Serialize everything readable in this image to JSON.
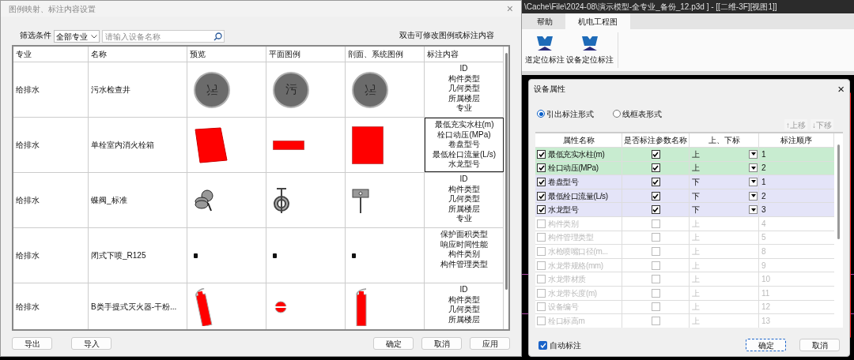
{
  "app": {
    "title": "\\Cache\\File\\2024-08\\演示模型-全专业_备份_12.p3d ] - [[二维-3F][视图1]]",
    "tabs": [
      {
        "label": "帮助",
        "selected": false
      },
      {
        "label": "机电工程图",
        "selected": true
      }
    ],
    "ribbon_buttons": [
      "道定位标注",
      "设备定位标注"
    ]
  },
  "legend_dialog": {
    "title": "图例映射、标注内容设置",
    "close": "×",
    "filter_label": "筛选条件",
    "specialty": "全部专业",
    "search": {
      "placeholder": "请输入设备名称"
    },
    "hint": "双击可修改图例或标注内容",
    "columns": [
      "专业",
      "名称",
      "预览",
      "平面图例",
      "剖面、系统图例",
      "标注内容"
    ],
    "rows": [
      {
        "specialty": "给排水",
        "name": "污水检查井",
        "kind": "manhole",
        "symbols": [
          "污",
          "污",
          "污"
        ],
        "annotations": [
          "ID",
          "构件类型",
          "几何类型",
          "所属楼层",
          "专业"
        ],
        "selected": false
      },
      {
        "specialty": "给排水",
        "name": "单栓室内消火栓箱",
        "kind": "hydrant_box",
        "annotations": [
          "最低充实水柱(m)",
          "栓口动压(MPa)",
          "卷盘型号",
          "最低栓口流量(L/s)",
          "水龙型号"
        ],
        "selected": true
      },
      {
        "specialty": "给排水",
        "name": "蝶阀_标准",
        "kind": "valve",
        "annotations": [
          "ID",
          "构件类型",
          "几何类型",
          "所属楼层",
          "专业"
        ],
        "selected": false
      },
      {
        "specialty": "给排水",
        "name": "闭式下喷_R125",
        "kind": "sprinkler",
        "annotations": [
          "保护面积类型",
          "响应时间性能",
          "构件类别",
          "构件管理类型"
        ],
        "selected": false
      },
      {
        "specialty": "给排水",
        "name": "B类手提式灭火器-干粉...",
        "kind": "extinguisher",
        "annotations": [
          "ID",
          "构件类型",
          "几何类型",
          "所属楼层"
        ],
        "selected": false
      }
    ],
    "left_buttons": [
      "导出",
      "导入"
    ],
    "right_buttons": [
      "确定",
      "取消",
      "应用"
    ]
  },
  "property_dialog": {
    "title": "设备属性",
    "close": "×",
    "modes": [
      {
        "label": "引出标注形式",
        "selected": true
      },
      {
        "label": "线框表形式",
        "selected": false
      }
    ],
    "move_buttons": [
      "↑上移",
      "↓下移"
    ],
    "columns": [
      "属性名称",
      "是否标注参数名称",
      "上、下标",
      "标注顺序"
    ],
    "rows": [
      {
        "checked": true,
        "name": "最低充实水柱(m)",
        "label_checked": true,
        "position": "上",
        "order": "1",
        "color": "#c8ecd0"
      },
      {
        "checked": true,
        "name": "栓口动压(MPa)",
        "label_checked": true,
        "position": "上",
        "order": "2",
        "color": "#c8ecd0"
      },
      {
        "checked": true,
        "name": "卷盘型号",
        "label_checked": true,
        "position": "下",
        "order": "1",
        "color": "#e4e4f8"
      },
      {
        "checked": true,
        "name": "最低栓口流量(L/s)",
        "label_checked": true,
        "position": "下",
        "order": "2",
        "color": "#e4e4f8"
      },
      {
        "checked": true,
        "name": "水龙型号",
        "label_checked": true,
        "position": "下",
        "order": "3",
        "color": "#e4e4f8"
      },
      {
        "checked": false,
        "name": "构件类别",
        "label_checked": false,
        "position": "上",
        "order": "4"
      },
      {
        "checked": false,
        "name": "构件管理类型",
        "label_checked": false,
        "position": "上",
        "order": "5"
      },
      {
        "checked": false,
        "name": "水枪喷嘴口径(m...",
        "label_checked": false,
        "position": "上",
        "order": "8"
      },
      {
        "checked": false,
        "name": "水龙带规格(mm)",
        "label_checked": false,
        "position": "上",
        "order": "9"
      },
      {
        "checked": false,
        "name": "水龙带材质",
        "label_checked": false,
        "position": "上",
        "order": "10"
      },
      {
        "checked": false,
        "name": "水龙带长度(m)",
        "label_checked": false,
        "position": "上",
        "order": "11"
      },
      {
        "checked": false,
        "name": "设备编号",
        "label_checked": false,
        "position": "上",
        "order": "12"
      },
      {
        "checked": false,
        "name": "栓口标高m",
        "label_checked": false,
        "position": "上",
        "order": "13"
      }
    ],
    "auto_label": {
      "label": "自动标注",
      "checked": true
    },
    "buttons": [
      "确定",
      "取消"
    ]
  }
}
